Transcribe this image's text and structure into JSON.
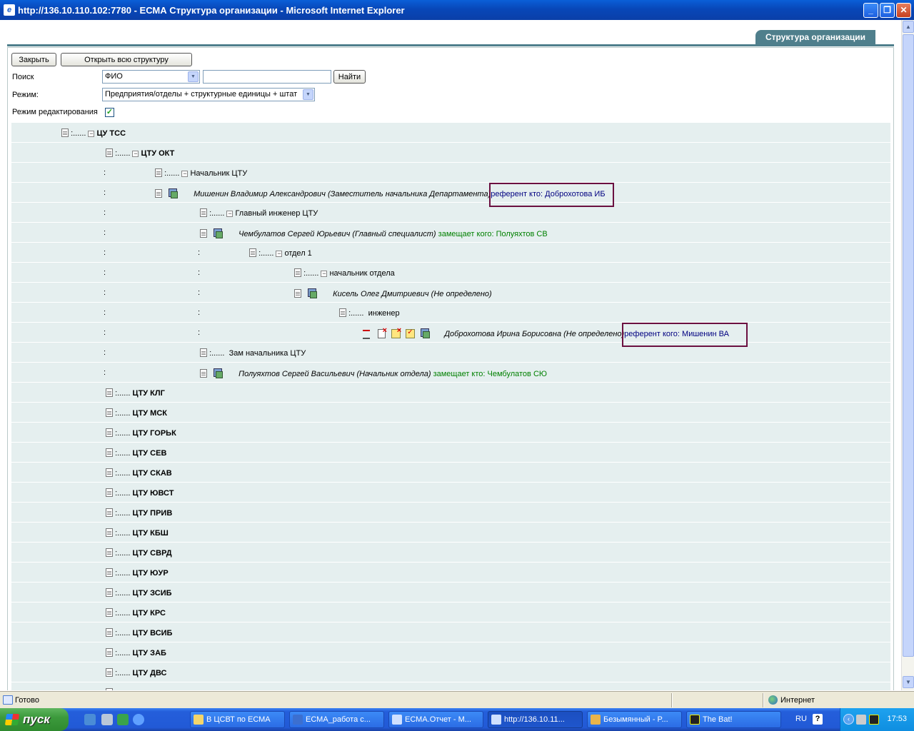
{
  "window": {
    "title": "http://136.10.110.102:7780 - ЕСМА Структура организации - Microsoft Internet Explorer",
    "minimize": "_",
    "restore": "❐",
    "close": "✕"
  },
  "page": {
    "tab_label": "Структура организации",
    "close_button": "Закрыть",
    "open_all_button": "Открыть всю структуру",
    "search_label": "Поиск",
    "search_field_value": "ФИО",
    "search_input_value": "",
    "find_button": "Найти",
    "mode_label": "Режим:",
    "mode_value": "Предприятия/отделы + структурные единицы + штат",
    "edit_mode_label": "Режим редактирования",
    "edit_mode_checked": true
  },
  "tree": {
    "dots": ":......",
    "dots_short": ":......",
    "colon": ":",
    "root": "ЦУ ТСС",
    "n1": "ЦТУ ОКТ",
    "n2": "Начальник ЦТУ",
    "p1_name": "Мишенин Владимир Александрович (Заместитель начальника Департамента)",
    "p1_link": "референт кто: Доброхотова ИБ",
    "n3": "Главный инженер ЦТУ",
    "p2_name": "Чембулатов Сергей Юрьевич (Главный специалист)",
    "p2_link": "замещает кого: Полуяхтов СВ",
    "n4": "отдел 1",
    "n5": "начальник отдела",
    "p3_name": "Кисель Олег Дмитриевич (Не определено)",
    "n6": "инженер",
    "p4_name": "Доброхотова Ирина Борисовна (Не определено)",
    "p4_link": "референт кого: Мишенин ВА",
    "n7": "Зам начальника ЦТУ",
    "p5_name": "Полуяхтов Сергей Васильевич (Начальник отдела)",
    "p5_link": "замещает кто: Чембулатов СЮ",
    "units": [
      "ЦТУ КЛГ",
      "ЦТУ МСК",
      "ЦТУ ГОРЬК",
      "ЦТУ СЕВ",
      "ЦТУ СКАВ",
      "ЦТУ ЮВСТ",
      "ЦТУ ПРИВ",
      "ЦТУ КБШ",
      "ЦТУ СВРД",
      "ЦТУ ЮУР",
      "ЦТУ ЗСИБ",
      "ЦТУ КРС",
      "ЦТУ ВСИБ",
      "ЦТУ ЗАБ",
      "ЦТУ ДВС"
    ]
  },
  "status": {
    "text": "Готово",
    "zone": "Интернет"
  },
  "taskbar": {
    "start": "пуск",
    "tasks": [
      "В ЦСВТ по ЕСМА",
      "ЕСМА_работа с...",
      "ЕСМА.Отчет - М...",
      "http://136.10.11...",
      "Безымянный - P...",
      "The Bat!"
    ],
    "lang": "RU",
    "help": "?",
    "clock": "17:53"
  },
  "colors": {
    "accent": "#4f7f8c",
    "row_bg": "#e5efef",
    "link_blue": "#000080",
    "link_green": "#008000",
    "highlight_box": "#6b1040"
  }
}
